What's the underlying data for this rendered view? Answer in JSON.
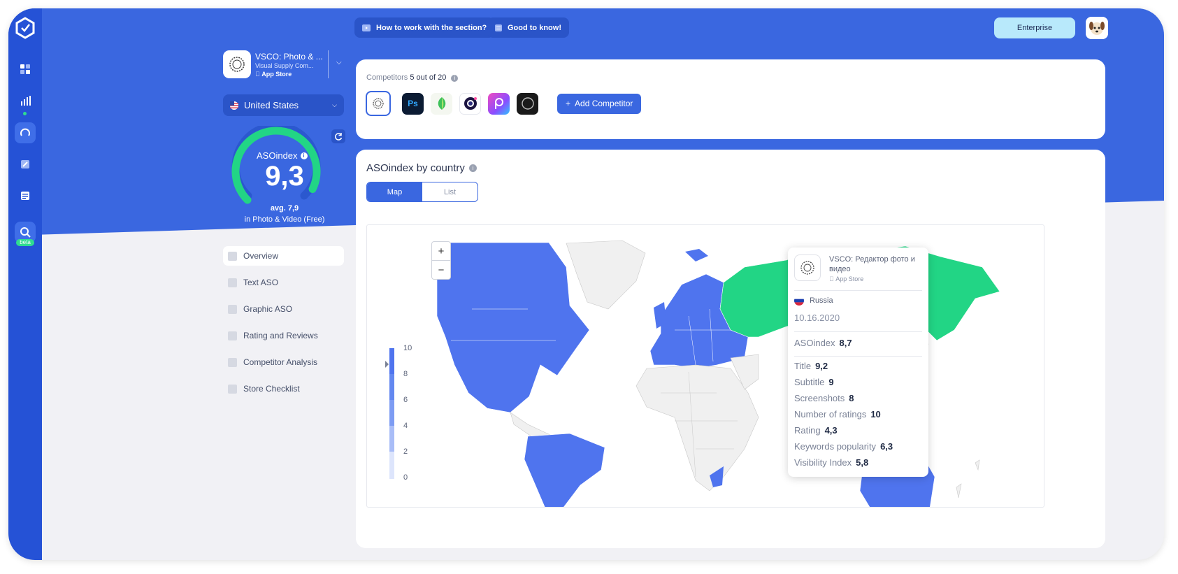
{
  "top": {
    "how_to": "How to work with the section?",
    "good_to_know": "Good to know!",
    "plan": "Enterprise"
  },
  "app": {
    "name": "VSCO: Photo & ...",
    "developer": "Visual Supply Com...",
    "store": "App Store"
  },
  "country": "United States",
  "asoindex": {
    "label": "ASOindex",
    "value": "9,3",
    "value_fraction": 0.93,
    "avg": "avg. 7,9",
    "category": "in Photo & Video (Free)"
  },
  "menu": [
    {
      "label": "Overview",
      "active": true
    },
    {
      "label": "Text ASO"
    },
    {
      "label": "Graphic ASO"
    },
    {
      "label": "Rating and Reviews"
    },
    {
      "label": "Competitor Analysis"
    },
    {
      "label": "Store Checklist"
    }
  ],
  "competitors": {
    "title": "Competitors",
    "count": "5 out of 20",
    "add": "Add Competitor",
    "icons": [
      "vsco-icon",
      "photoshop-icon",
      "snapseed-icon",
      "camera-icon",
      "picsart-icon",
      "circle-app-icon"
    ]
  },
  "map": {
    "title": "ASOindex by country",
    "toggle": [
      "Map",
      "List"
    ],
    "zoom_in": "+",
    "zoom_out": "−",
    "legend": [
      "10",
      "8",
      "6",
      "4",
      "2",
      "0"
    ]
  },
  "tooltip": {
    "app_name": "VSCO: Редактор фото и видео",
    "store": "App Store",
    "country": "Russia",
    "date": "10.16.2020",
    "asoindex_label": "ASOindex",
    "asoindex_value": "8,7",
    "metrics": [
      {
        "label": "Title",
        "value": "9,2"
      },
      {
        "label": "Subtitle",
        "value": "9"
      },
      {
        "label": "Screenshots",
        "value": "8"
      },
      {
        "label": "Number of ratings",
        "value": "10"
      },
      {
        "label": "Rating",
        "value": "4,3"
      },
      {
        "label": "Keywords popularity",
        "value": "6,3"
      },
      {
        "label": "Visibility Index",
        "value": "5,8"
      }
    ]
  },
  "colors": {
    "primary": "#3a67e0",
    "sidebar": "#2552d6",
    "accent_green": "#2fdc90",
    "map_blue": "#4f74ee"
  }
}
